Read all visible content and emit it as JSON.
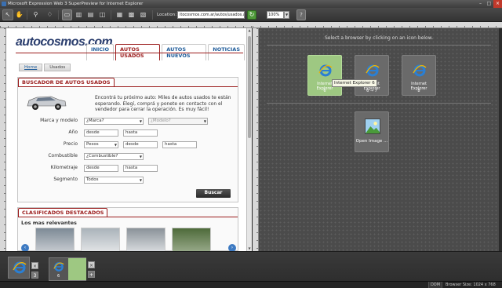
{
  "window": {
    "title": "Microsoft Expression Web 3 SuperPreview for Internet Explorer"
  },
  "toolbar": {
    "location_label": "Location:",
    "url": "itocosmos.com.ar/autos/usados.aspx",
    "zoom": "100%",
    "go_icon": "refresh-arrow-icon"
  },
  "page": {
    "logo": "autocosmos.com",
    "nav": [
      "INICIO",
      "AUTOS USADOS",
      "AUTOS NUEVOS",
      "NOTICIAS"
    ],
    "breadcrumb": [
      "Home",
      "Usados"
    ],
    "search_box": {
      "title": "BUSCADOR DE AUTOS USADOS",
      "description": "Encontrá tu próximo auto: Miles de autos usados te están esperando. Elegí, comprá y ponete en contacto con el vendedor para cerrar la operación. Es muy fácil!",
      "fields": {
        "marca_label": "Marca y modelo",
        "marca_value": "¿Marca?",
        "modelo_value": "¿Modelo?",
        "anio_label": "Año",
        "anio_desde": "desde",
        "anio_hasta": "hasta",
        "precio_label": "Precio",
        "precio_currency": "Pesos",
        "precio_desde": "desde",
        "precio_hasta": "hasta",
        "combustible_label": "Combustible",
        "combustible_value": "¿Combustible?",
        "km_label": "Kilometraje",
        "km_desde": "desde",
        "km_hasta": "hasta",
        "segmento_label": "Segmento",
        "segmento_value": "Todos"
      },
      "button": "Buscar"
    },
    "featured": {
      "title": "CLASIFICADOS DESTACADOS",
      "subtitle": "Los mas relevantes"
    }
  },
  "right_panel": {
    "instruction": "Select a browser by clicking on an icon below.",
    "browsers": [
      {
        "name": "Internet Explorer",
        "version": "6",
        "selected": true
      },
      {
        "name": "Internet Explorer",
        "version": "6 → 7",
        "selected": false
      },
      {
        "name": "Internet Explorer",
        "version": "8",
        "selected": false
      }
    ],
    "tooltip": "Internet Explorer 6",
    "open_image": "Open Image ..."
  },
  "bottom": {
    "baseline_version": "3",
    "tile_version": "6"
  },
  "status": {
    "dom": "DOM",
    "browser_size": "Browser Size: 1024 x 768"
  }
}
